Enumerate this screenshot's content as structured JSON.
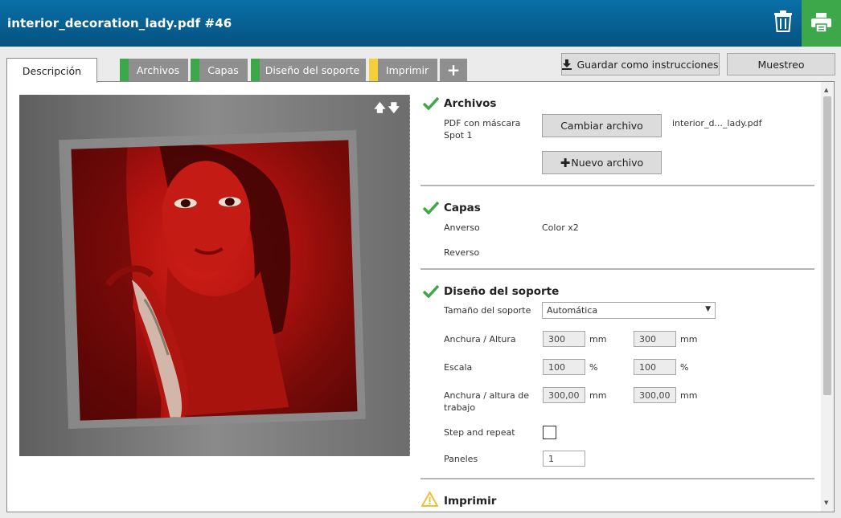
{
  "header": {
    "title": "interior_decoration_lady.pdf #46"
  },
  "tabs": {
    "active": "Descripción",
    "items": [
      {
        "label": "Archivos",
        "status_color": "#3ca84a"
      },
      {
        "label": "Capas",
        "status_color": "#3ca84a"
      },
      {
        "label": "Diseño del soporte",
        "status_color": "#3ca84a"
      },
      {
        "label": "Imprimir",
        "status_color": "#f5cf3a"
      }
    ],
    "add": "+"
  },
  "toolbar": {
    "save_label": "Guardar como instrucciones",
    "sample_label": "Muestreo"
  },
  "preview": {
    "arrows": "🡅🡇"
  },
  "archivos": {
    "title": "Archivos",
    "pdf_label": "PDF con máscara",
    "spot_label": "Spot 1",
    "change_button": "Cambiar archivo",
    "filename": "interior_d..._lady.pdf",
    "new_button": "Nuevo archivo"
  },
  "capas": {
    "title": "Capas",
    "front_label": "Anverso",
    "front_value": "Color x2",
    "back_label": "Reverso"
  },
  "diseno": {
    "title": "Diseño del soporte",
    "media_size_label": "Tamaño del soporte",
    "media_size_value": "Automática",
    "width_height_label": "Anchura / Altura",
    "width_value": "300",
    "height_value": "300",
    "unit_mm": "mm",
    "scale_label": "Escala",
    "scale_x": "100",
    "scale_y": "100",
    "unit_pct": "%",
    "work_label_1": "Anchura / altura de",
    "work_label_2": "trabajo",
    "work_width": "300,00",
    "work_height": "300,00",
    "step_repeat_label": "Step and repeat",
    "panels_label": "Paneles",
    "panels_value": "1"
  },
  "imprimir": {
    "title": "Imprimir"
  },
  "colors": {
    "header": "#05527f",
    "accent_green": "#3ca84a",
    "warning_yellow": "#f5cf3a"
  }
}
